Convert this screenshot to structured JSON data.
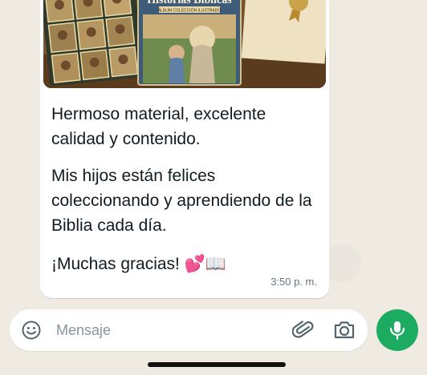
{
  "message": {
    "media": {
      "book_title": "Historias Bíblicas",
      "book_subtitle": "ÁLBUM COLECCIÓN ILUSTRADO"
    },
    "paragraphs": [
      "Hermoso material, excelente calidad y contenido.",
      "Mis hijos están felices coleccionando y aprendiendo de la Biblia cada día.",
      "¡Muchas gracias! 💕📖"
    ],
    "time": "3:50 p. m."
  },
  "composer": {
    "placeholder": "Mensaje",
    "value": "",
    "icons": [
      "emoji-icon",
      "attach-icon",
      "camera-icon",
      "mic-icon"
    ]
  },
  "colors": {
    "background": "#efeae2",
    "bubble": "#ffffff",
    "accent": "#1daa61",
    "text": "#111b21",
    "muted": "#667781"
  }
}
